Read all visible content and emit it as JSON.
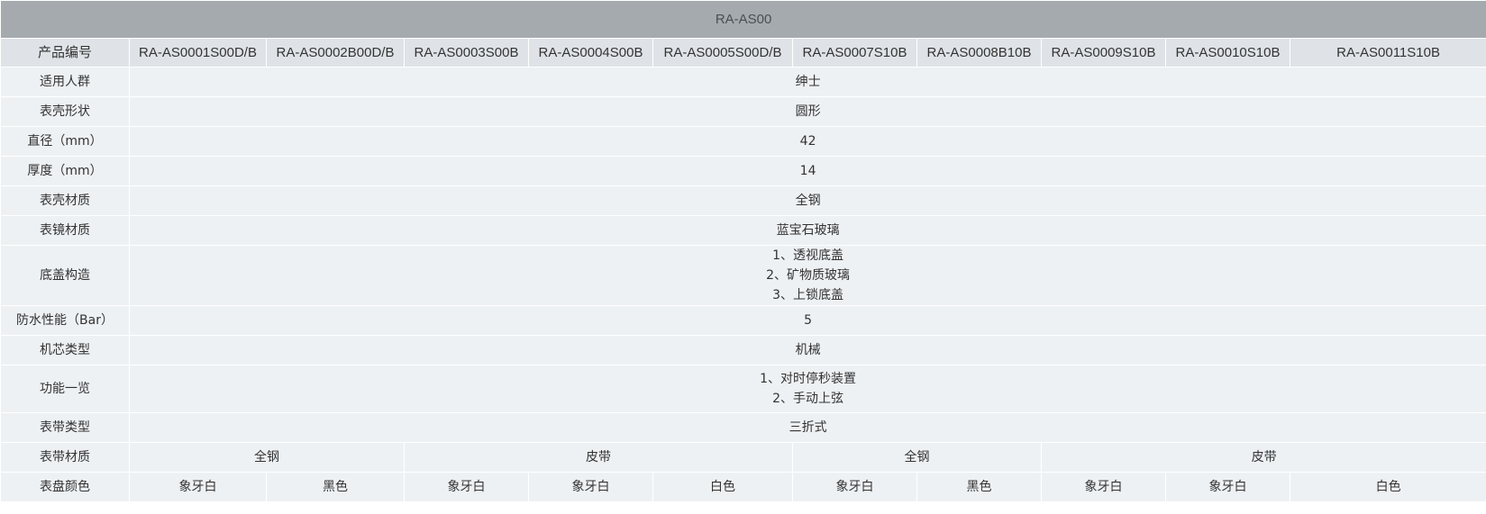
{
  "table": {
    "title": "RA-AS00",
    "model_label": "产品编号",
    "models": [
      "RA-AS0001S00D/B",
      "RA-AS0002B00D/B",
      "RA-AS0003S00B",
      "RA-AS0004S00B",
      "RA-AS0005S00D/B",
      "RA-AS0007S10B",
      "RA-AS0008B10B",
      "RA-AS0009S10B",
      "RA-AS0010S10B",
      "RA-AS0011S10B"
    ],
    "specs": {
      "audience": {
        "label": "适用人群",
        "value": "绅士"
      },
      "case_shape": {
        "label": "表壳形状",
        "value": "圆形"
      },
      "diameter": {
        "label": "直径（mm）",
        "value": "42"
      },
      "thickness": {
        "label": "厚度（mm）",
        "value": "14"
      },
      "case_material": {
        "label": "表壳材质",
        "value": "全钢"
      },
      "crystal_material": {
        "label": "表镜材质",
        "value": "蓝宝石玻璃"
      },
      "caseback": {
        "label": "底盖构造",
        "lines": [
          "1、透视底盖",
          "2、矿物质玻璃",
          "3、上锁底盖"
        ]
      },
      "water_resistance": {
        "label": "防水性能（Bar）",
        "value": "5"
      },
      "movement": {
        "label": "机芯类型",
        "value": "机械"
      },
      "functions": {
        "label": "功能一览",
        "lines": [
          "1、对时停秒装置",
          "2、手动上弦"
        ]
      },
      "strap_type": {
        "label": "表带类型",
        "value": "三折式"
      },
      "strap_material": {
        "label": "表带材质",
        "groups": [
          "全钢",
          "皮带",
          "全钢",
          "皮带"
        ]
      },
      "dial_color": {
        "label": "表盘颜色",
        "values": [
          "象牙白",
          "黑色",
          "象牙白",
          "象牙白",
          "白色",
          "象牙白",
          "黑色",
          "象牙白",
          "象牙白",
          "白色"
        ]
      }
    }
  }
}
